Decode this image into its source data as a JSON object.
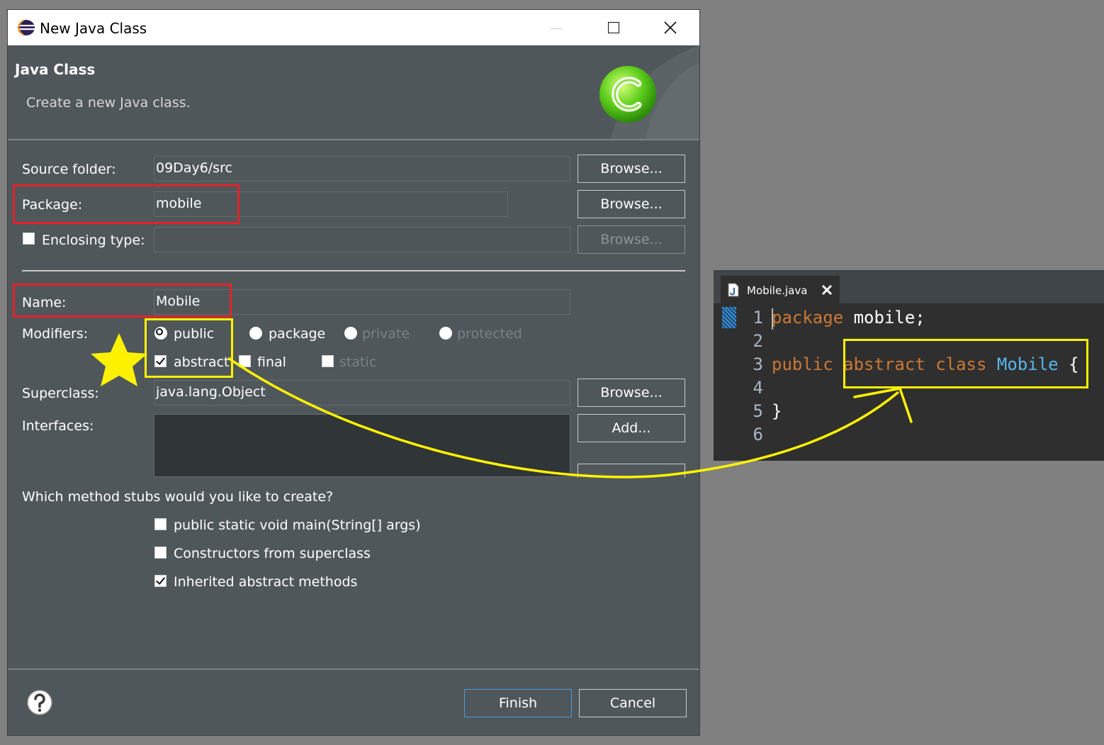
{
  "window": {
    "title": "New Java Class"
  },
  "header": {
    "title": "Java Class",
    "description": "Create a new Java class."
  },
  "form": {
    "source_folder": {
      "label": "Source folder:",
      "value": "09Day6/src",
      "browse": "Browse..."
    },
    "package": {
      "label": "Package:",
      "value": "mobile",
      "browse": "Browse..."
    },
    "enclosing_type": {
      "label": "Enclosing type:",
      "value": "",
      "browse": "Browse...",
      "checked": false
    },
    "name": {
      "label": "Name:",
      "value": "Mobile"
    },
    "modifiers": {
      "label": "Modifiers:",
      "access": [
        {
          "label": "public",
          "selected": true,
          "enabled": true
        },
        {
          "label": "package",
          "selected": false,
          "enabled": true
        },
        {
          "label": "private",
          "selected": false,
          "enabled": false
        },
        {
          "label": "protected",
          "selected": false,
          "enabled": false
        }
      ],
      "flags": [
        {
          "label": "abstract",
          "checked": true,
          "enabled": true
        },
        {
          "label": "final",
          "checked": false,
          "enabled": true
        },
        {
          "label": "static",
          "checked": false,
          "enabled": false
        }
      ]
    },
    "superclass": {
      "label": "Superclass:",
      "value": "java.lang.Object",
      "browse": "Browse..."
    },
    "interfaces": {
      "label": "Interfaces:",
      "add": "Add..."
    },
    "stubs": {
      "question": "Which method stubs would you like to create?",
      "options": [
        {
          "label": "public static void main(String[] args)",
          "checked": false
        },
        {
          "label": "Constructors from superclass",
          "checked": false
        },
        {
          "label": "Inherited abstract methods",
          "checked": true
        }
      ]
    }
  },
  "footer": {
    "finish": "Finish",
    "cancel": "Cancel"
  },
  "editor": {
    "tab_label": "Mobile.java",
    "line_numbers": [
      "1",
      "2",
      "3",
      "4",
      "5",
      "6"
    ],
    "lines": {
      "l1_kw": "package",
      "l1_rest": " mobile;",
      "l3_kw1": "public",
      "l3_kw2": "abstract",
      "l3_kw3": "class",
      "l3_cls": "Mobile",
      "l3_brace": "{",
      "l5": "}"
    }
  },
  "colors": {
    "dialog_bg": "#50575b",
    "keyword": "#cc7832",
    "class_name": "#56b6e8",
    "annotation_red": "#e3222a",
    "annotation_yellow": "#fff200"
  }
}
